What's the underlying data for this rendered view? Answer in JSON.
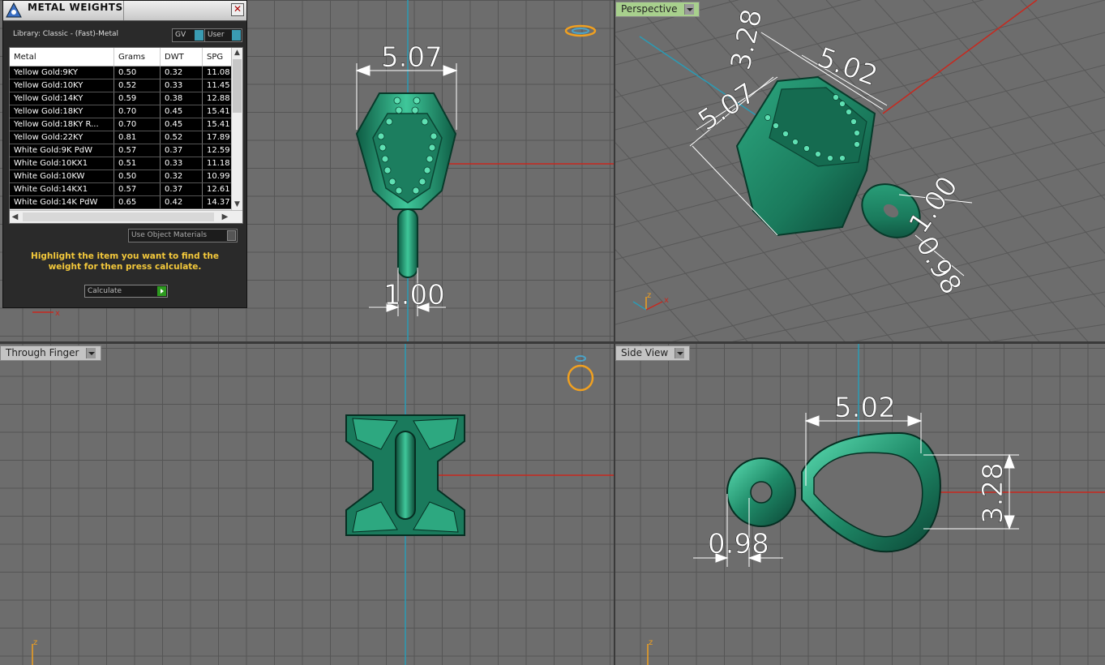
{
  "viewports": {
    "top": {
      "label": ""
    },
    "perspective": {
      "label": "Perspective"
    },
    "through_finger": {
      "label": "Through Finger"
    },
    "side": {
      "label": "Side View"
    }
  },
  "dimensions": {
    "top_width": "5.07",
    "top_bail": "1.00",
    "persp_a": "3.28",
    "persp_b": "5.02",
    "persp_c": "5.07",
    "persp_d": "1.00",
    "persp_e": "0.98",
    "side_width": "5.02",
    "side_height": "3.28",
    "side_bail": "0.98"
  },
  "axis_labels": {
    "x": "x",
    "z": "z"
  },
  "metal_panel": {
    "title": "METAL WEIGHTS",
    "close_glyph": "✕",
    "library": "Library: Classic - (Fast)-Metal",
    "gv_label": "GV",
    "user_label": "User",
    "columns": [
      "Metal",
      "Grams",
      "DWT",
      "SPG"
    ],
    "rows": [
      [
        "Yellow Gold:9KY",
        "0.50",
        "0.32",
        "11.08"
      ],
      [
        "Yellow Gold:10KY",
        "0.52",
        "0.33",
        "11.45"
      ],
      [
        "Yellow Gold:14KY",
        "0.59",
        "0.38",
        "12.88"
      ],
      [
        "Yellow Gold:18KY",
        "0.70",
        "0.45",
        "15.41"
      ],
      [
        "Yellow Gold:18KY R...",
        "0.70",
        "0.45",
        "15.41"
      ],
      [
        "Yellow Gold:22KY",
        "0.81",
        "0.52",
        "17.89"
      ],
      [
        "White Gold:9K PdW",
        "0.57",
        "0.37",
        "12.59"
      ],
      [
        "White Gold:10KX1",
        "0.51",
        "0.33",
        "11.18"
      ],
      [
        "White Gold:10KW",
        "0.50",
        "0.32",
        "10.99"
      ],
      [
        "White Gold:14KX1",
        "0.57",
        "0.37",
        "12.61"
      ],
      [
        "White Gold:14K PdW",
        "0.65",
        "0.42",
        "14.37"
      ]
    ],
    "use_object_materials": "Use Object Materials",
    "hint": "Highlight the item you want to find the weight for then press calculate.",
    "calculate": "Calculate"
  },
  "colors": {
    "model": "#1f8a68",
    "model_light": "#4fd0a4",
    "model_dark": "#0c4a36",
    "axis_red": "#c8281e",
    "axis_blue": "#2a9bb5",
    "highlight_text": "#f3c83b"
  }
}
